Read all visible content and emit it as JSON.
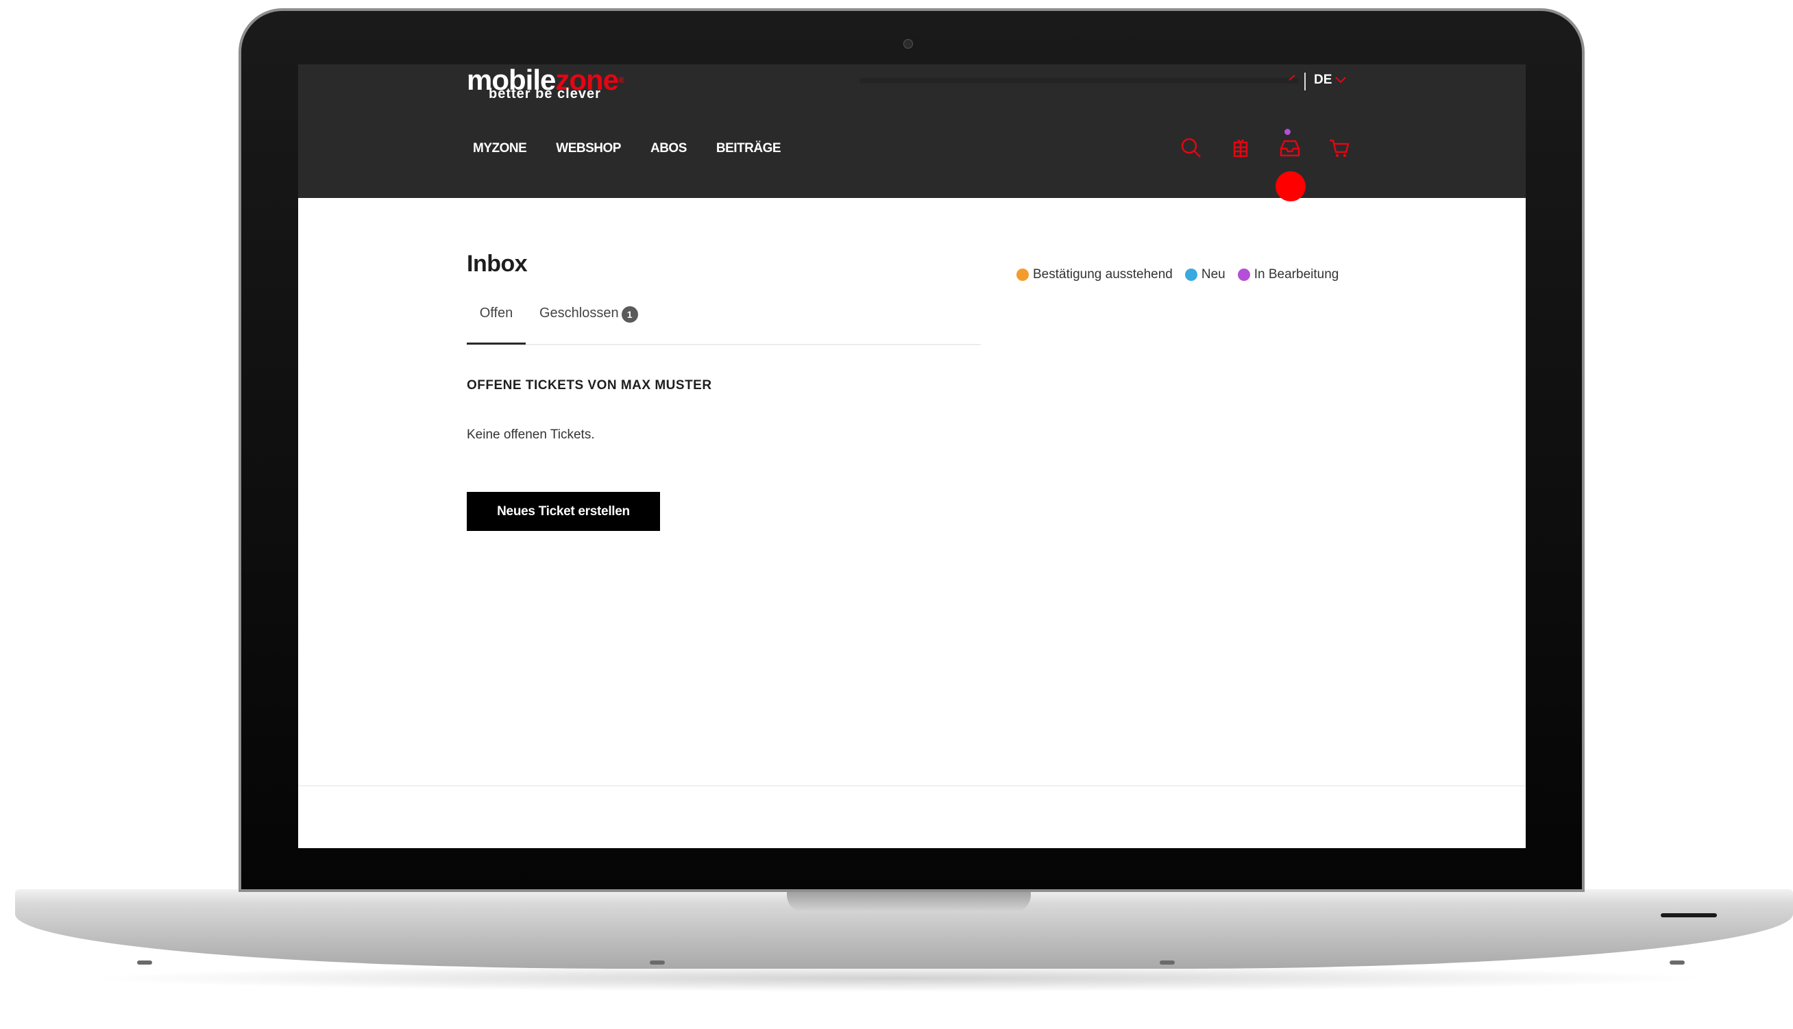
{
  "header": {
    "logo": {
      "word_part1": "mobile",
      "word_part2": "zone",
      "registered": "®",
      "tagline": "better be clever"
    },
    "language": {
      "label": "DE"
    },
    "nav": [
      {
        "label": "MYZONE"
      },
      {
        "label": "WEBSHOP"
      },
      {
        "label": "ABOS"
      },
      {
        "label": "BEITRÄGE"
      }
    ],
    "icons": [
      "search-icon",
      "gift-icon",
      "inbox-icon",
      "cart-icon"
    ]
  },
  "main": {
    "title": "Inbox",
    "tabs": [
      {
        "label": "Offen",
        "active": true
      },
      {
        "label": "Geschlossen",
        "badge": "1"
      }
    ],
    "legend": [
      {
        "label": "Bestätigung ausstehend",
        "color": "#f39c2b"
      },
      {
        "label": "Neu",
        "color": "#3aa9e0"
      },
      {
        "label": "In Bearbeitung",
        "color": "#b44fd6"
      }
    ],
    "section_heading": "OFFENE TICKETS VON MAX MUSTER",
    "empty_message": "Keine offenen Tickets.",
    "create_button_label": "Neues Ticket erstellen"
  },
  "colors": {
    "brand_red": "#e30613",
    "header_bg": "#2a2a2a",
    "button_bg": "#000000"
  }
}
